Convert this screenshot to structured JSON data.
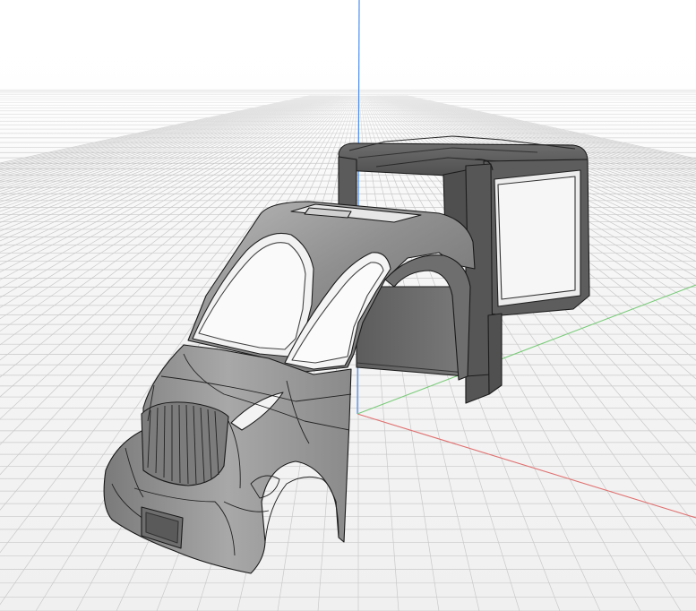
{
  "app": {
    "view": "perspective",
    "background_color": "#ffffff",
    "grid_color": "#c8c8c8",
    "axis_colors": {
      "x": "#e06c6c",
      "y": "#6cc46c",
      "z": "#4a8ef0"
    }
  },
  "scene": {
    "objects": [
      {
        "name": "front-cabin-shell",
        "icon": "mesh-object",
        "color": "#8f8f8f"
      },
      {
        "name": "rear-cargo-frame",
        "icon": "mesh-object",
        "color": "#5a5a5a"
      }
    ]
  }
}
